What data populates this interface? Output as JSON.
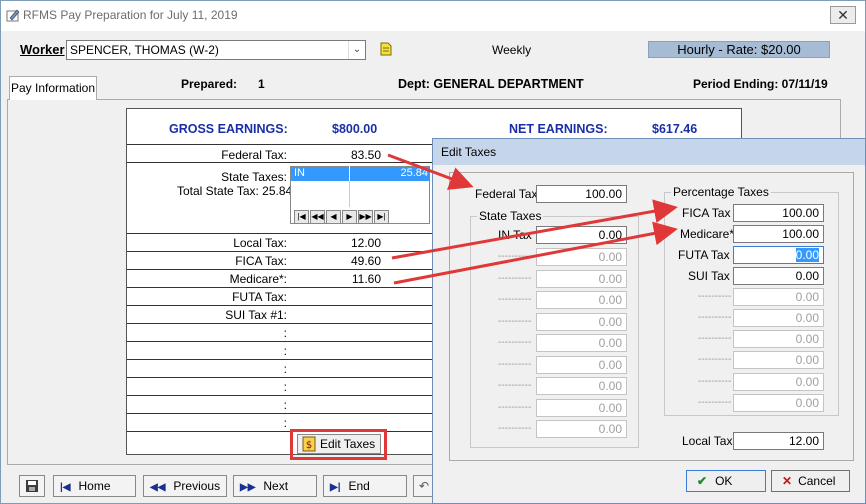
{
  "window": {
    "title": "RFMS Pay Preparation for July 11, 2019",
    "close_glyph": "✕"
  },
  "worker": {
    "label": "Worker",
    "value": "SPENCER, THOMAS (W-2)",
    "frequency": "Weekly",
    "rate": "Hourly - Rate: $20.00"
  },
  "tab": {
    "label": "Pay Information"
  },
  "header": {
    "prepared_label": "Prepared:",
    "prepared_value": "1",
    "dept": "Dept: GENERAL DEPARTMENT",
    "period": "Period Ending: 07/11/19"
  },
  "earnings": {
    "gross_label": "GROSS EARNINGS:",
    "gross_value": "$800.00",
    "net_label": "NET EARNINGS:",
    "net_value": "$617.46"
  },
  "taxes": {
    "federal_label": "Federal Tax:",
    "federal_value": "83.50",
    "state_label": "State Taxes:",
    "total_state": "Total State Tax: 25.84",
    "state_row_state": "IN",
    "state_row_value": "25.84",
    "local_label": "Local Tax:",
    "local_value": "12.00",
    "fica_label": "FICA Tax:",
    "fica_value": "49.60",
    "medicare_label": "Medicare*:",
    "medicare_value": "11.60",
    "futa_label": "FUTA Tax:",
    "sui_label": "SUI Tax #1:",
    "colons": [
      ":",
      ":",
      ":",
      ":",
      ":",
      ":"
    ]
  },
  "nav_glyphs": [
    "|◀",
    "◀◀",
    "◀",
    "▶",
    "▶▶",
    "▶|"
  ],
  "edit_taxes_button": "Edit Taxes",
  "bottom_nav": {
    "home": "Home",
    "previous": "Previous",
    "next": "Next",
    "end": "End"
  },
  "dialog": {
    "title": "Edit Taxes",
    "federal_label": "Federal Tax",
    "federal_value": "100.00",
    "state_group": "State Taxes",
    "in_label": "IN Tax",
    "in_value": "0.00",
    "dash": "----------",
    "zero": "0.00",
    "pct_group": "Percentage Taxes",
    "fica_label": "FICA Tax",
    "fica_value": "100.00",
    "medicare_label": "Medicare*",
    "medicare_value": "100.00",
    "futa_label": "FUTA Tax",
    "futa_value": "0.00",
    "sui_label": "SUI Tax",
    "sui_value": "0.00",
    "local_label": "Local Tax",
    "local_value": "12.00",
    "ok": "OK",
    "cancel": "Cancel"
  },
  "colors": {
    "accent": "#1a2fa6",
    "highlight": "#e03838",
    "selection": "#3399ff",
    "rate_bg": "#a6bcd5"
  }
}
